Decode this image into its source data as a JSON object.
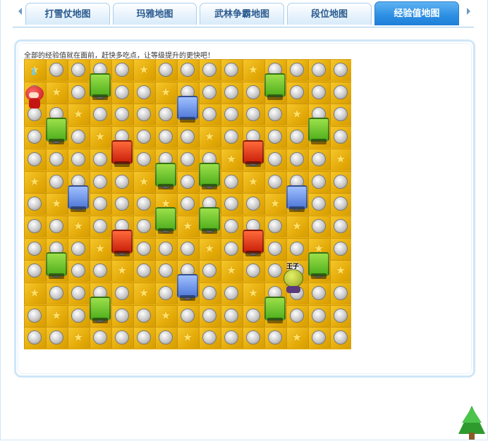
{
  "tabs": [
    {
      "label": "打雪仗地图",
      "active": false
    },
    {
      "label": "玛雅地图",
      "active": false
    },
    {
      "label": "武林争霸地图",
      "active": false
    },
    {
      "label": "段位地图",
      "active": false
    },
    {
      "label": "经验值地图",
      "active": true
    }
  ],
  "content": {
    "caption": "全部的经验值就在面前，赶快多吃点，让等级提升的更快吧！"
  },
  "game": {
    "enemy_name": "王子",
    "grid_columns": 15,
    "grid_rows": 13,
    "colors": {
      "floor": "#e9b30c",
      "box_green": "#4fae1d",
      "box_blue": "#4f78d8",
      "box_red": "#c81e0a",
      "tab_active": "#2b8ee3"
    }
  },
  "icons": {
    "scroll_left": "triangle-left-icon",
    "scroll_right": "triangle-right-icon",
    "decoration": "tree-icon"
  }
}
